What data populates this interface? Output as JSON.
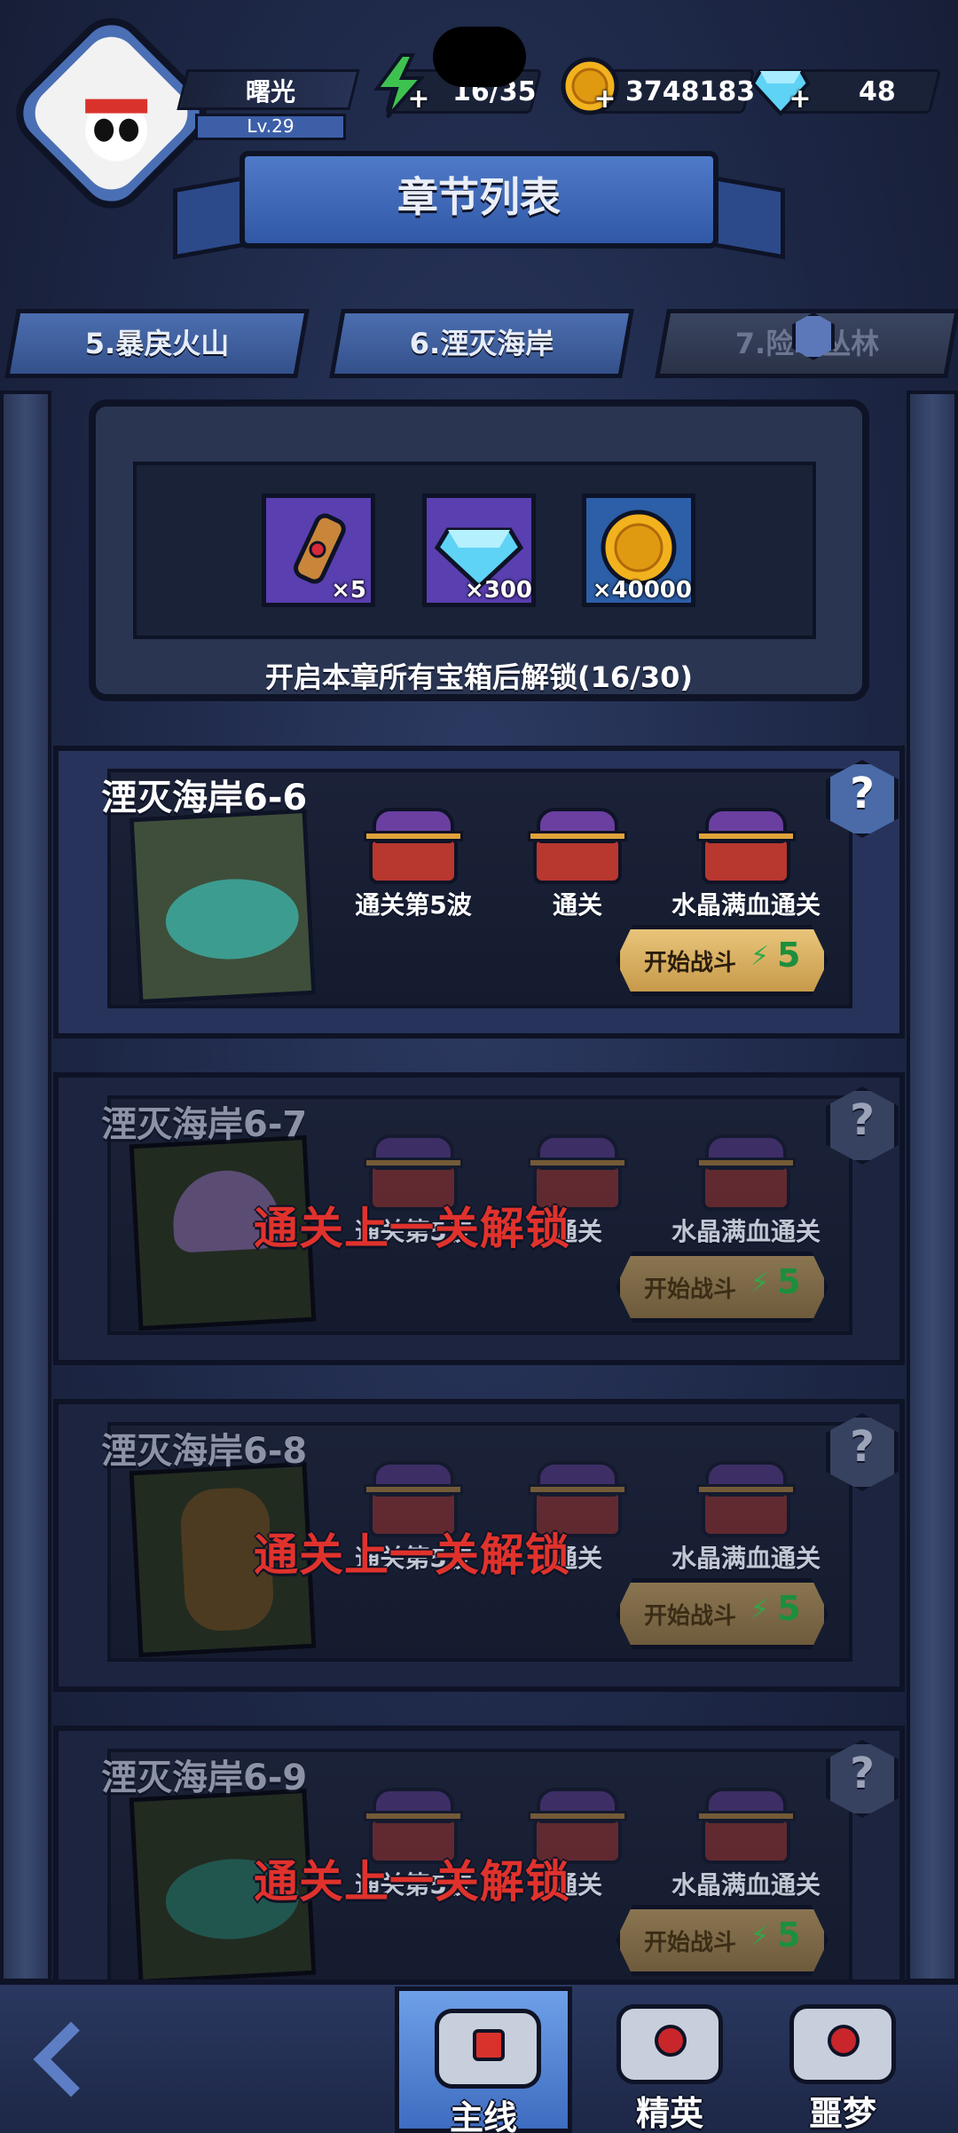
{
  "player": {
    "name": "曙光",
    "level": "Lv.29"
  },
  "resources": {
    "energy": "16/35",
    "coins": "3748183",
    "gems": "48"
  },
  "title": "章节列表",
  "chapters": [
    {
      "label": "5.暴戾火山"
    },
    {
      "label": "6.湮灭海岸"
    },
    {
      "label": "7.险峻丛林"
    }
  ],
  "chapter_rewards": {
    "items": [
      {
        "icon": "scroll-icon",
        "count": "×5"
      },
      {
        "icon": "gem-icon",
        "count": "×300"
      },
      {
        "icon": "coin-icon",
        "count": "×40000"
      }
    ],
    "unlock_note": "开启本章所有宝箱后解锁(16/30)"
  },
  "levels": [
    {
      "title": "湮灭海岸6-6",
      "locked": false,
      "chests": [
        "通关第5波",
        "通关",
        "水晶满血通关"
      ],
      "battle_label": "开始战斗",
      "cost": "5",
      "lock_message": ""
    },
    {
      "title": "湮灭海岸6-7",
      "locked": true,
      "chests": [
        "通关第5波",
        "通关",
        "水晶满血通关"
      ],
      "battle_label": "开始战斗",
      "cost": "5",
      "lock_message": "通关上一关解锁"
    },
    {
      "title": "湮灭海岸6-8",
      "locked": true,
      "chests": [
        "通关第5波",
        "通关",
        "水晶满血通关"
      ],
      "battle_label": "开始战斗",
      "cost": "5",
      "lock_message": "通关上一关解锁"
    },
    {
      "title": "湮灭海岸6-9",
      "locked": true,
      "chests": [
        "通关第5波",
        "通关",
        "水晶满血通关"
      ],
      "battle_label": "开始战斗",
      "cost": "5",
      "lock_message": "通关上一关解锁"
    }
  ],
  "help_symbol": "?",
  "bolt_symbol": "⚡",
  "plus_symbol": "+",
  "bottom_nav": [
    {
      "label": "主线",
      "active": true
    },
    {
      "label": "精英",
      "active": false
    },
    {
      "label": "噩梦",
      "active": false
    }
  ],
  "colors": {
    "accent_blue": "#3e6cc0",
    "energy_green": "#2fa84a",
    "lock_red": "#e0322c",
    "button_gold": "#c79a4a"
  }
}
